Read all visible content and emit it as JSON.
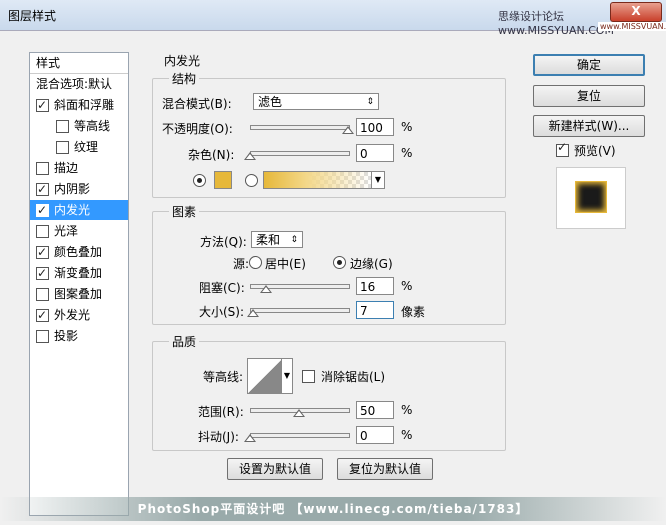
{
  "window": {
    "title": "图层样式",
    "forum_watermark": "思缘设计论坛 www.MISSYUAN.COM",
    "close_label": "X",
    "close_watermark": "www.MISSVUAN.COM"
  },
  "left_list": {
    "header": "样式",
    "items": [
      {
        "label": "混合选项:默认",
        "checkbox": false,
        "checked": false,
        "indent": false,
        "selected": false
      },
      {
        "label": "斜面和浮雕",
        "checkbox": true,
        "checked": true,
        "indent": false,
        "selected": false
      },
      {
        "label": "等高线",
        "checkbox": true,
        "checked": false,
        "indent": true,
        "selected": false
      },
      {
        "label": "纹理",
        "checkbox": true,
        "checked": false,
        "indent": true,
        "selected": false
      },
      {
        "label": "描边",
        "checkbox": true,
        "checked": false,
        "indent": false,
        "selected": false
      },
      {
        "label": "内阴影",
        "checkbox": true,
        "checked": true,
        "indent": false,
        "selected": false
      },
      {
        "label": "内发光",
        "checkbox": true,
        "checked": true,
        "indent": false,
        "selected": true
      },
      {
        "label": "光泽",
        "checkbox": true,
        "checked": false,
        "indent": false,
        "selected": false
      },
      {
        "label": "颜色叠加",
        "checkbox": true,
        "checked": true,
        "indent": false,
        "selected": false
      },
      {
        "label": "渐变叠加",
        "checkbox": true,
        "checked": true,
        "indent": false,
        "selected": false
      },
      {
        "label": "图案叠加",
        "checkbox": true,
        "checked": false,
        "indent": false,
        "selected": false
      },
      {
        "label": "外发光",
        "checkbox": true,
        "checked": true,
        "indent": false,
        "selected": false
      },
      {
        "label": "投影",
        "checkbox": true,
        "checked": false,
        "indent": false,
        "selected": false
      }
    ]
  },
  "inner_glow": {
    "title": "内发光",
    "structure": {
      "title": "结构",
      "blend_mode_label": "混合模式(B):",
      "blend_mode_value": "滤色",
      "opacity_label": "不透明度(O):",
      "opacity_value": "100",
      "opacity_level": 1.0,
      "noise_label": "杂色(N):",
      "noise_value": "0",
      "noise_level": 0.0,
      "percent": "%",
      "color": "#e6b83a",
      "source_mode": "solid"
    },
    "elements": {
      "title": "图素",
      "technique_label": "方法(Q):",
      "technique_value": "柔和",
      "source_label": "源:",
      "center_label": "居中(E)",
      "edge_label": "边缘(G)",
      "source_value": "edge",
      "choke_label": "阻塞(C):",
      "choke_value": "16",
      "choke_level": 0.16,
      "size_label": "大小(S):",
      "size_value": "7",
      "size_unit": "像素",
      "size_level": 0.028,
      "percent": "%"
    },
    "quality": {
      "title": "品质",
      "contour_label": "等高线:",
      "antialias_label": "消除锯齿(L)",
      "antialias_checked": false,
      "range_label": "范围(R):",
      "range_value": "50",
      "range_level": 0.5,
      "jitter_label": "抖动(J):",
      "jitter_value": "0",
      "jitter_level": 0.0,
      "percent": "%"
    },
    "make_default_label": "设置为默认值",
    "reset_default_label": "复位为默认值"
  },
  "right_panel": {
    "ok_label": "确定",
    "reset_label": "复位",
    "new_style_label": "新建样式(W)...",
    "preview_label": "预览(V)",
    "preview_checked": true
  },
  "watermark": "PhotoShop平面设计吧 【www.linecg.com/tieba/1783】"
}
